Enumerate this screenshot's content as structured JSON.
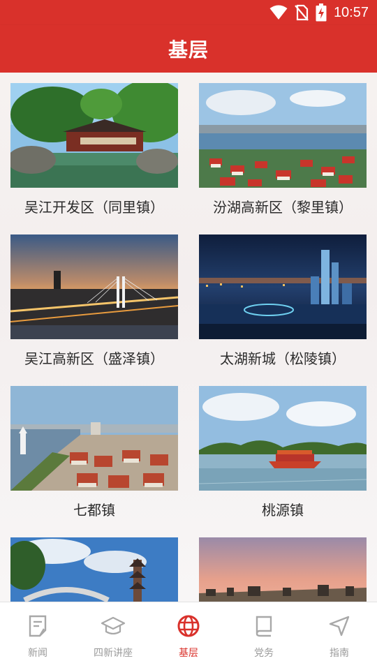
{
  "status_bar": {
    "time": "10:57",
    "icons": [
      "wifi-icon",
      "no-sim-icon",
      "battery-charging-icon"
    ]
  },
  "header": {
    "title": "基层"
  },
  "colors": {
    "brand_red": "#d9312b",
    "inactive_gray": "#9a9a9a",
    "active_red": "#d9312b"
  },
  "towns": [
    {
      "label": "吴江开发区（同里镇）",
      "image": "classical-garden-pavilion"
    },
    {
      "label": "汾湖高新区（黎里镇）",
      "image": "lakeside-villas"
    },
    {
      "label": "吴江高新区（盛泽镇）",
      "image": "cable-stayed-bridge-dusk"
    },
    {
      "label": "太湖新城（松陵镇）",
      "image": "night-skyline"
    },
    {
      "label": "七都镇",
      "image": "lakeside-tower-town"
    },
    {
      "label": "桃源镇",
      "image": "wooden-boat-on-lake"
    },
    {
      "label": "",
      "image": "stone-bridge-pagoda"
    },
    {
      "label": "",
      "image": "sunset-cityscape"
    }
  ],
  "bottom_nav": [
    {
      "label": "新闻",
      "icon": "news-icon",
      "active": false
    },
    {
      "label": "四新讲座",
      "icon": "graduation-cap-icon",
      "active": false
    },
    {
      "label": "基层",
      "icon": "globe-icon",
      "active": true
    },
    {
      "label": "党务",
      "icon": "book-icon",
      "active": false
    },
    {
      "label": "指南",
      "icon": "navigation-arrow-icon",
      "active": false
    }
  ]
}
